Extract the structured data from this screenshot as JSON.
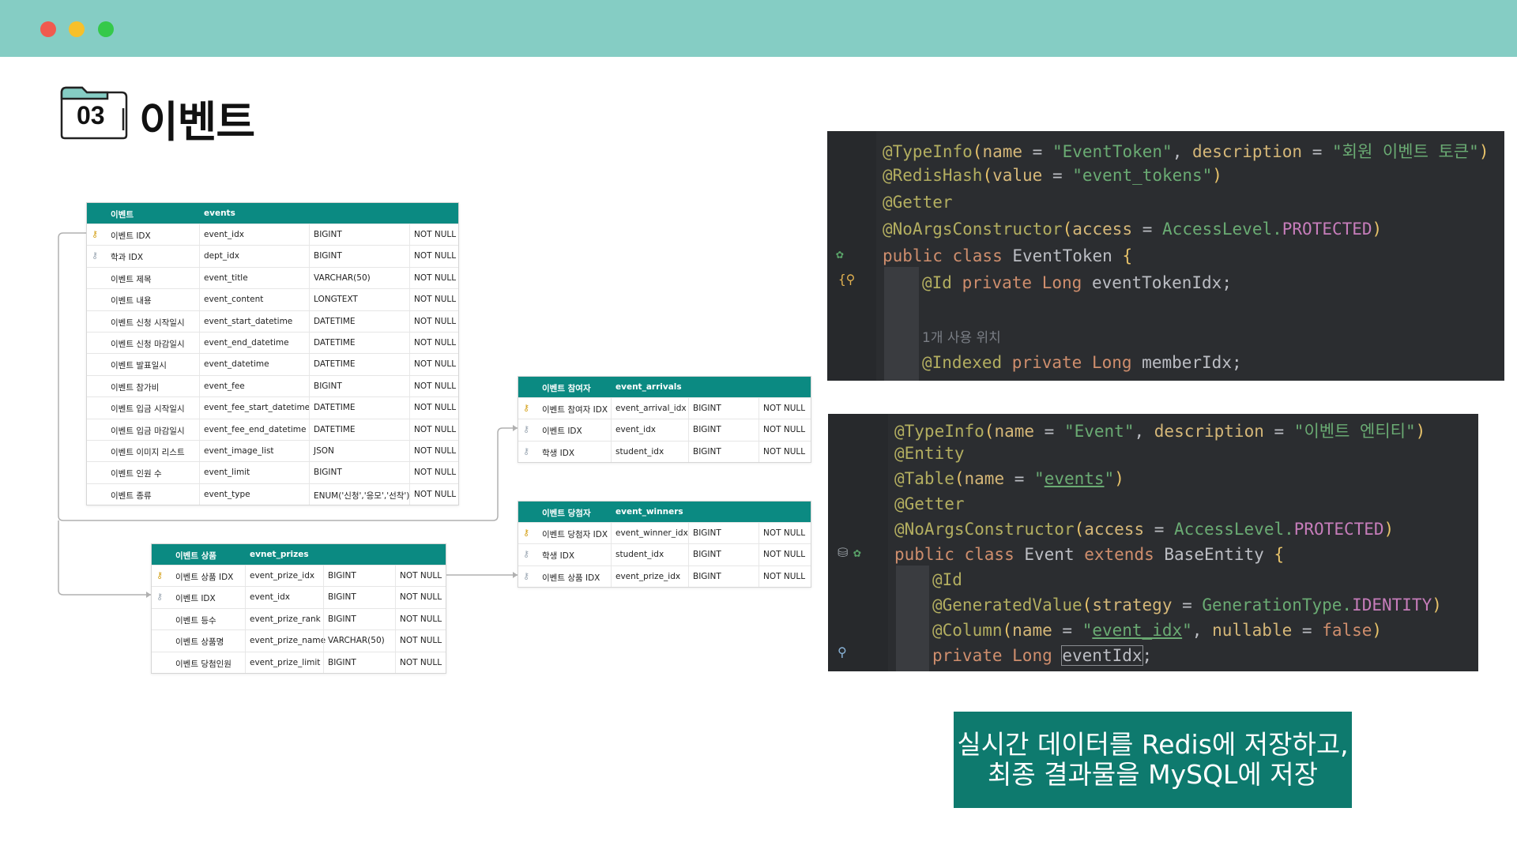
{
  "window": {
    "controls": [
      "close",
      "minimize",
      "maximize"
    ]
  },
  "section": {
    "number": "03",
    "title": "이벤트"
  },
  "erd": {
    "events": {
      "label": "이벤트",
      "name": "events",
      "rows": [
        {
          "key": "pk",
          "kor": "이벤트 IDX",
          "col": "event_idx",
          "type": "BIGINT",
          "null": "NOT NULL"
        },
        {
          "key": "fk",
          "kor": "학과 IDX",
          "col": "dept_idx",
          "type": "BIGINT",
          "null": "NOT NULL"
        },
        {
          "key": "",
          "kor": "이벤트 제목",
          "col": "event_title",
          "type": "VARCHAR(50)",
          "null": "NOT NULL"
        },
        {
          "key": "",
          "kor": "이벤트 내용",
          "col": "event_content",
          "type": "LONGTEXT",
          "null": "NOT NULL"
        },
        {
          "key": "",
          "kor": "이벤트 신청 시작일시",
          "col": "event_start_datetime",
          "type": "DATETIME",
          "null": "NOT NULL"
        },
        {
          "key": "",
          "kor": "이벤트 신청 마감일시",
          "col": "event_end_datetime",
          "type": "DATETIME",
          "null": "NOT NULL"
        },
        {
          "key": "",
          "kor": "이벤트 발표일시",
          "col": "event_datetime",
          "type": "DATETIME",
          "null": "NOT NULL"
        },
        {
          "key": "",
          "kor": "이벤트 참가비",
          "col": "event_fee",
          "type": "BIGINT",
          "null": "NOT NULL"
        },
        {
          "key": "",
          "kor": "이벤트 입금 시작일시",
          "col": "event_fee_start_datetime",
          "type": "DATETIME",
          "null": "NOT NULL"
        },
        {
          "key": "",
          "kor": "이벤트 입금 마감일시",
          "col": "event_fee_end_datetime",
          "type": "DATETIME",
          "null": "NOT NULL"
        },
        {
          "key": "",
          "kor": "이벤트 이미지 리스트",
          "col": "event_image_list",
          "type": "JSON",
          "null": "NOT NULL"
        },
        {
          "key": "",
          "kor": "이벤트 인원 수",
          "col": "event_limit",
          "type": "BIGINT",
          "null": "NOT NULL"
        },
        {
          "key": "",
          "kor": "이벤트 종류",
          "col": "event_type",
          "type": "ENUM('신청','응모','선착')",
          "null": "NOT NULL"
        }
      ]
    },
    "arrivals": {
      "label": "이벤트 참여자",
      "name": "event_arrivals",
      "rows": [
        {
          "key": "pk",
          "kor": "이벤트 참여자 IDX",
          "col": "event_arrival_idx",
          "type": "BIGINT",
          "null": "NOT NULL"
        },
        {
          "key": "fk",
          "kor": "이벤트 IDX",
          "col": "event_idx",
          "type": "BIGINT",
          "null": "NOT NULL"
        },
        {
          "key": "fk",
          "kor": "학생 IDX",
          "col": "student_idx",
          "type": "BIGINT",
          "null": "NOT NULL"
        }
      ]
    },
    "winners": {
      "label": "이벤트 당첨자",
      "name": "event_winners",
      "rows": [
        {
          "key": "pk",
          "kor": "이벤트 당첨자 IDX",
          "col": "event_winner_idx",
          "type": "BIGINT",
          "null": "NOT NULL"
        },
        {
          "key": "fk",
          "kor": "학생 IDX",
          "col": "student_idx",
          "type": "BIGINT",
          "null": "NOT NULL"
        },
        {
          "key": "fk",
          "kor": "이벤트 상품 IDX",
          "col": "event_prize_idx",
          "type": "BIGINT",
          "null": "NOT NULL"
        }
      ]
    },
    "prizes": {
      "label": "이벤트 상품",
      "name": "evnet_prizes",
      "rows": [
        {
          "key": "pk",
          "kor": "이벤트 상품 IDX",
          "col": "event_prize_idx",
          "type": "BIGINT",
          "null": "NOT NULL"
        },
        {
          "key": "fk",
          "kor": "이벤트 IDX",
          "col": "event_idx",
          "type": "BIGINT",
          "null": "NOT NULL"
        },
        {
          "key": "",
          "kor": "이벤트 등수",
          "col": "event_prize_rank",
          "type": "BIGINT",
          "null": "NOT NULL"
        },
        {
          "key": "",
          "kor": "이벤트 상품명",
          "col": "event_prize_name",
          "type": "VARCHAR(50)",
          "null": "NOT NULL"
        },
        {
          "key": "",
          "kor": "이벤트 당첨인원",
          "col": "event_prize_limit",
          "type": "BIGINT",
          "null": "NOT NULL"
        }
      ]
    }
  },
  "code1": {
    "l1": {
      "ann": "@TypeInfo",
      "p1": "(",
      "k1": "name",
      "eq1": " = ",
      "s1": "\"EventToken\"",
      "c1": ", ",
      "k2": "description",
      "eq2": " = ",
      "s2": "\"회원 이벤트 토큰\"",
      "p2": ")"
    },
    "l2": {
      "ann": "@RedisHash",
      "p1": "(",
      "k1": "value",
      "eq1": " = ",
      "s1": "\"event_tokens\"",
      "p2": ")"
    },
    "l3": {
      "ann": "@Getter"
    },
    "l4": {
      "ann": "@NoArgsConstructor",
      "p1": "(",
      "k1": "access",
      "eq1": " = ",
      "t1": "AccessLevel.",
      "c1": "PROTECTED",
      "p2": ")"
    },
    "l5": {
      "kw": "public class ",
      "cls": "EventToken ",
      "brace": "{"
    },
    "l6": {
      "ann": "@Id ",
      "kw": "private ",
      "kw2": "Long ",
      "name": "eventTokenIdx;"
    },
    "l7": {
      "hint": "1개 사용 위치"
    },
    "l8": {
      "ann": "@Indexed ",
      "kw": "private ",
      "kw2": "Long ",
      "name": "memberIdx;"
    }
  },
  "code2": {
    "l1": {
      "ann": "@TypeInfo",
      "p1": "(",
      "k1": "name",
      "eq1": " = ",
      "s1": "\"Event\"",
      "c1": ", ",
      "k2": "description",
      "eq2": " = ",
      "s2": "\"이벤트 엔티티\"",
      "p2": ")"
    },
    "l2": {
      "ann": "@Entity"
    },
    "l3": {
      "ann": "@Table",
      "p1": "(",
      "k1": "name",
      "eq1": " = ",
      "q1": "\"",
      "s1": "events",
      "q2": "\"",
      "p2": ")"
    },
    "l4": {
      "ann": "@Getter"
    },
    "l5": {
      "ann": "@NoArgsConstructor",
      "p1": "(",
      "k1": "access",
      "eq1": " = ",
      "t1": "AccessLevel.",
      "c1": "PROTECTED",
      "p2": ")"
    },
    "l6": {
      "kw": "public class ",
      "cls": "Event ",
      "kw2": "extends ",
      "cls2": "BaseEntity ",
      "brace": "{"
    },
    "l7": {
      "ann": "@Id"
    },
    "l8": {
      "ann": "@GeneratedValue",
      "p1": "(",
      "k1": "strategy",
      "eq1": " = ",
      "t1": "GenerationType.",
      "c1": "IDENTITY",
      "p2": ")"
    },
    "l9": {
      "ann": "@Column",
      "p1": "(",
      "k1": "name",
      "eq1": " = ",
      "q1": "\"",
      "s1": "event_idx",
      "q2": "\"",
      "c1": ", ",
      "k2": "nullable",
      "eq2": " = ",
      "kw": "false",
      "p2": ")"
    },
    "l10": {
      "kw": "private ",
      "kw2": "Long ",
      "name": "eventIdx",
      "semi": ";"
    }
  },
  "note": {
    "line1": "실시간 데이터를 Redis에 저장하고,",
    "line2": "최종 결과물을 MySQL에 저장"
  },
  "colors": {
    "topbar": "#85cdc4",
    "table_header": "#0b8a82",
    "note_bg": "#0e7a6e",
    "code_bg": "#2b2d30"
  }
}
